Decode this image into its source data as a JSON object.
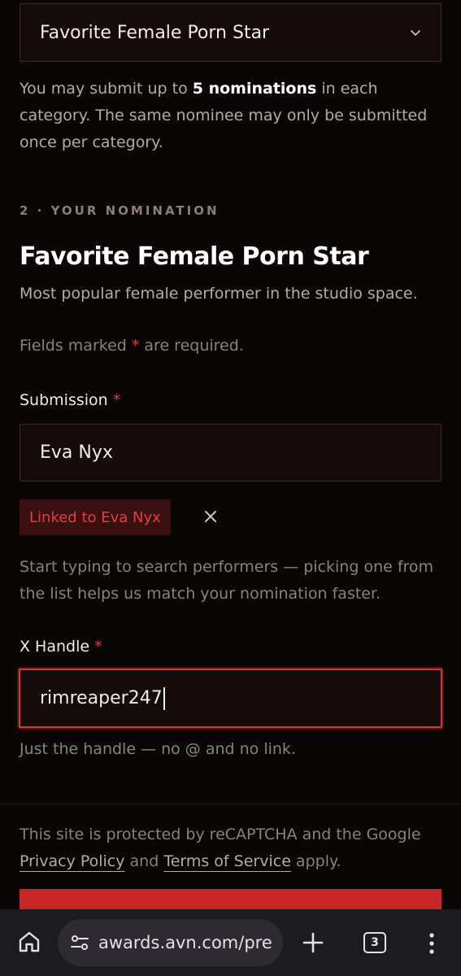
{
  "category_select": {
    "value": "Favorite Female Porn Star"
  },
  "limit_note": {
    "before": "You may submit up to ",
    "bold": "5 nominations",
    "after": " in each category. The same nominee may only be submitted once per category."
  },
  "step_label": "2 · YOUR NOMINATION",
  "category": {
    "title": "Favorite Female Porn Star",
    "description": "Most popular female performer in the studio space."
  },
  "required_note": {
    "before": "Fields marked ",
    "star": "*",
    "after": " are required."
  },
  "submission": {
    "label": "Submission",
    "star": "*",
    "value": "Eva Nyx",
    "linked_chip": "Linked to Eva Nyx",
    "hint": "Start typing to search performers — picking one from the list helps us match your nomination faster."
  },
  "x_handle": {
    "label": "X Handle",
    "star": "*",
    "value": "rimreaper247",
    "hint": "Just the handle — no @ and no link."
  },
  "recaptcha": {
    "before": "This site is protected by reCAPTCHA and the Google ",
    "privacy": "Privacy Policy",
    "middle": " and ",
    "terms": "Terms of Service",
    "after": " apply."
  },
  "browser": {
    "url": "awards.avn.com/pre",
    "tab_count": "3",
    "icons": [
      "home-icon",
      "site-settings-icon",
      "plus-icon",
      "tab-switcher-icon",
      "more-vert-icon"
    ]
  },
  "colors": {
    "accent": "#d23a3a",
    "background": "#0a0606",
    "chip_bg": "#3a0f10"
  }
}
